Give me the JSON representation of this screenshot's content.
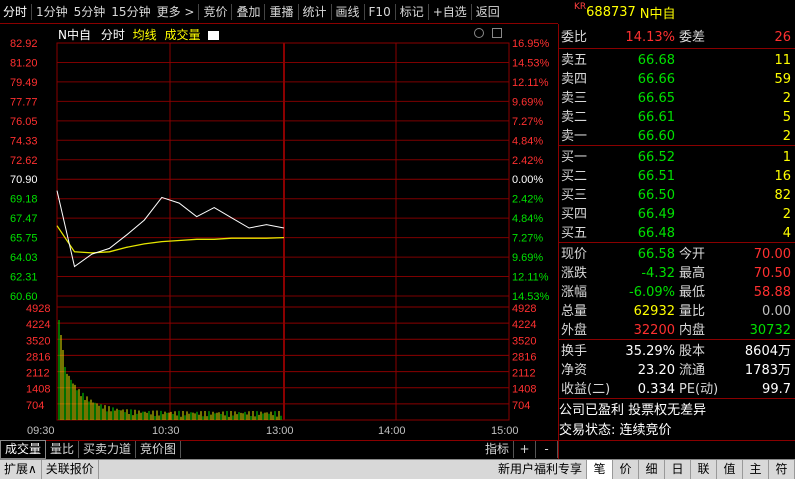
{
  "top_tabs": [
    "分时",
    "1分钟",
    "5分钟",
    "15分钟",
    "更多 >",
    "竞价",
    "叠加",
    "重播",
    "统计",
    "画线",
    "F10",
    "标记",
    "+自选",
    "返回"
  ],
  "stock": {
    "market": "KR",
    "code": "688737",
    "name": "N中自"
  },
  "chart": {
    "title": "N中自",
    "mode": "分时",
    "avg_label": "均线",
    "vol_label": "成交量",
    "price_ticks": [
      "82.92",
      "81.20",
      "79.49",
      "77.77",
      "76.05",
      "74.33",
      "72.62",
      "70.90",
      "69.18",
      "67.47",
      "65.75",
      "64.03",
      "62.31",
      "60.60"
    ],
    "pct_ticks": [
      "16.95%",
      "14.53%",
      "12.11%",
      "9.69%",
      "7.27%",
      "4.84%",
      "2.42%",
      "0.00%",
      "2.42%",
      "4.84%",
      "7.27%",
      "9.69%",
      "12.11%",
      "14.53%"
    ],
    "vol_ticks": [
      "4928",
      "4224",
      "3520",
      "2816",
      "2112",
      "1408",
      "704"
    ],
    "time_ticks": [
      "09:30",
      "10:30",
      "13:00",
      "14:00",
      "15:00"
    ],
    "colors": {
      "price": "#ffffff",
      "avg": "#e6e600",
      "up": "#ff3030",
      "down": "#00e000",
      "grid": "#8a0000"
    }
  },
  "chart_data": {
    "type": "line",
    "title": "N中自",
    "x": [
      "09:30",
      "09:40",
      "09:50",
      "10:00",
      "10:10",
      "10:20",
      "10:30",
      "10:40",
      "10:50",
      "11:00",
      "11:10",
      "11:20",
      "11:30",
      "13:00"
    ],
    "series": [
      {
        "name": "价格",
        "values": [
          69.9,
          63.2,
          64.3,
          64.8,
          66.0,
          67.3,
          69.3,
          68.8,
          67.6,
          68.4,
          67.5,
          66.6,
          66.9,
          66.6
        ]
      },
      {
        "name": "均线",
        "values": [
          66.8,
          64.5,
          64.4,
          64.5,
          64.9,
          65.2,
          65.4,
          65.5,
          65.6,
          65.6,
          65.7,
          65.7,
          65.7,
          65.75
        ]
      }
    ],
    "ylim": [
      60.6,
      82.92
    ],
    "ylabel": "",
    "xlabel": ""
  },
  "order_book": {
    "ratio_label": "委比",
    "ratio": "14.13%",
    "diff_label": "委差",
    "diff": "26",
    "asks": [
      {
        "label": "卖五",
        "price": "66.68",
        "vol": "11"
      },
      {
        "label": "卖四",
        "price": "66.66",
        "vol": "59"
      },
      {
        "label": "卖三",
        "price": "66.65",
        "vol": "2"
      },
      {
        "label": "卖二",
        "price": "66.61",
        "vol": "5"
      },
      {
        "label": "卖一",
        "price": "66.60",
        "vol": "2"
      }
    ],
    "bids": [
      {
        "label": "买一",
        "price": "66.52",
        "vol": "1"
      },
      {
        "label": "买二",
        "price": "66.51",
        "vol": "16"
      },
      {
        "label": "买三",
        "price": "66.50",
        "vol": "82"
      },
      {
        "label": "买四",
        "price": "66.49",
        "vol": "2"
      },
      {
        "label": "买五",
        "price": "66.48",
        "vol": "4"
      }
    ]
  },
  "quote": [
    {
      "l1": "现价",
      "v1": "66.58",
      "l2": "今开",
      "v2": "70.00"
    },
    {
      "l1": "涨跌",
      "v1": "-4.32",
      "l2": "最高",
      "v2": "70.50"
    },
    {
      "l1": "涨幅",
      "v1": "-6.09%",
      "l2": "最低",
      "v2": "58.88"
    },
    {
      "l1": "总量",
      "v1": "62932",
      "l2": "量比",
      "v2": "0.00"
    },
    {
      "l1": "外盘",
      "v1": "32200",
      "l2": "内盘",
      "v2": "30732"
    }
  ],
  "stats": [
    {
      "l1": "换手",
      "v1": "35.29%",
      "l2": "股本",
      "v2": "8604万"
    },
    {
      "l1": "净资",
      "v1": "23.20",
      "l2": "流通",
      "v2": "1783万"
    },
    {
      "l1": "收益(二)",
      "v1": "0.334",
      "l2": "PE(动)",
      "v2": "99.7"
    }
  ],
  "info": {
    "line1": "公司已盈利 投票权无差异",
    "line2": "交易状态: 连续竞价"
  },
  "bottom_tabs": [
    "成交量",
    "量比",
    "买卖力道",
    "竞价图"
  ],
  "bottom_right": [
    "指标",
    "+",
    "-"
  ],
  "status_left": [
    "扩展∧",
    "关联报价"
  ],
  "status_right": [
    "新用户福利专享",
    "笔",
    "价",
    "细",
    "日",
    "联",
    "值",
    "主",
    "符"
  ]
}
